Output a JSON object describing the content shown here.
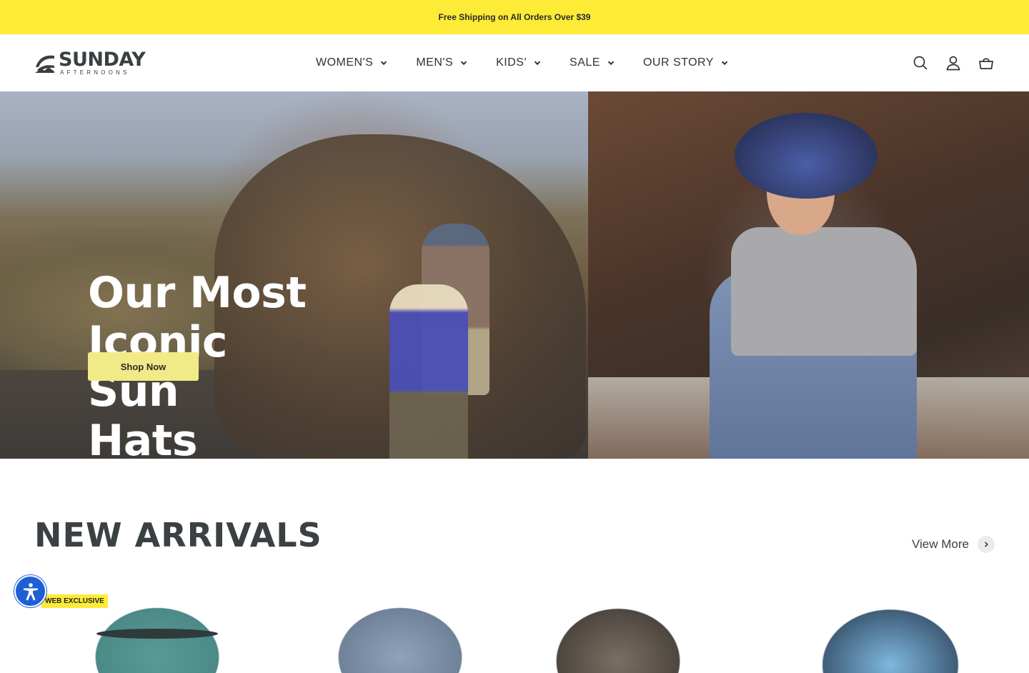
{
  "announcement": {
    "text": "Free Shipping on All Orders Over $39"
  },
  "brand": {
    "name": "SUNDAY",
    "tagline": "AFTERNOONS"
  },
  "nav": {
    "items": [
      {
        "label": "WOMEN'S"
      },
      {
        "label": "MEN'S"
      },
      {
        "label": "KIDS'"
      },
      {
        "label": "SALE"
      },
      {
        "label": "OUR STORY"
      }
    ]
  },
  "header_icons": [
    "search-icon",
    "account-icon",
    "cart-icon"
  ],
  "hero": {
    "title_line1": "Our Most",
    "title_line2": "Iconic Sun",
    "title_line3": "Hats",
    "cta": "Shop Now"
  },
  "new_arrivals": {
    "title": "NEW ARRIVALS",
    "view_more": "View More",
    "badge": "WEB EXCLUSIVE"
  },
  "colors": {
    "announcement_bg": "#fdeb37",
    "cta_bg": "#f2ea86",
    "accessibility_button": "#1f5fd6",
    "text_dark": "#2e3334"
  }
}
